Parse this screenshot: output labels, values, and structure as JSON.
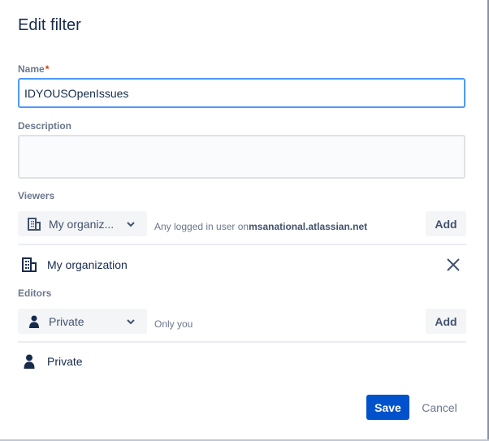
{
  "dialog": {
    "title": "Edit filter"
  },
  "name_field": {
    "label": "Name",
    "required_mark": "*",
    "value": "IDYOUSOpenIssues"
  },
  "description_field": {
    "label": "Description",
    "value": ""
  },
  "viewers": {
    "label": "Viewers",
    "selected": "My organiz...",
    "hint_prefix": "Any logged in user on",
    "hint_domain": "msanational.atlassian.net",
    "add_label": "Add",
    "entries": [
      {
        "label": "My organization",
        "icon": "building-icon"
      }
    ]
  },
  "editors": {
    "label": "Editors",
    "selected": "Private",
    "hint": "Only you",
    "add_label": "Add",
    "entries": [
      {
        "label": "Private",
        "icon": "person-icon"
      }
    ]
  },
  "actions": {
    "save_label": "Save",
    "cancel_label": "Cancel"
  },
  "colors": {
    "primary": "#0052cc",
    "focus": "#4c9aff",
    "text": "#172b4d",
    "subtle": "#6b778c"
  }
}
